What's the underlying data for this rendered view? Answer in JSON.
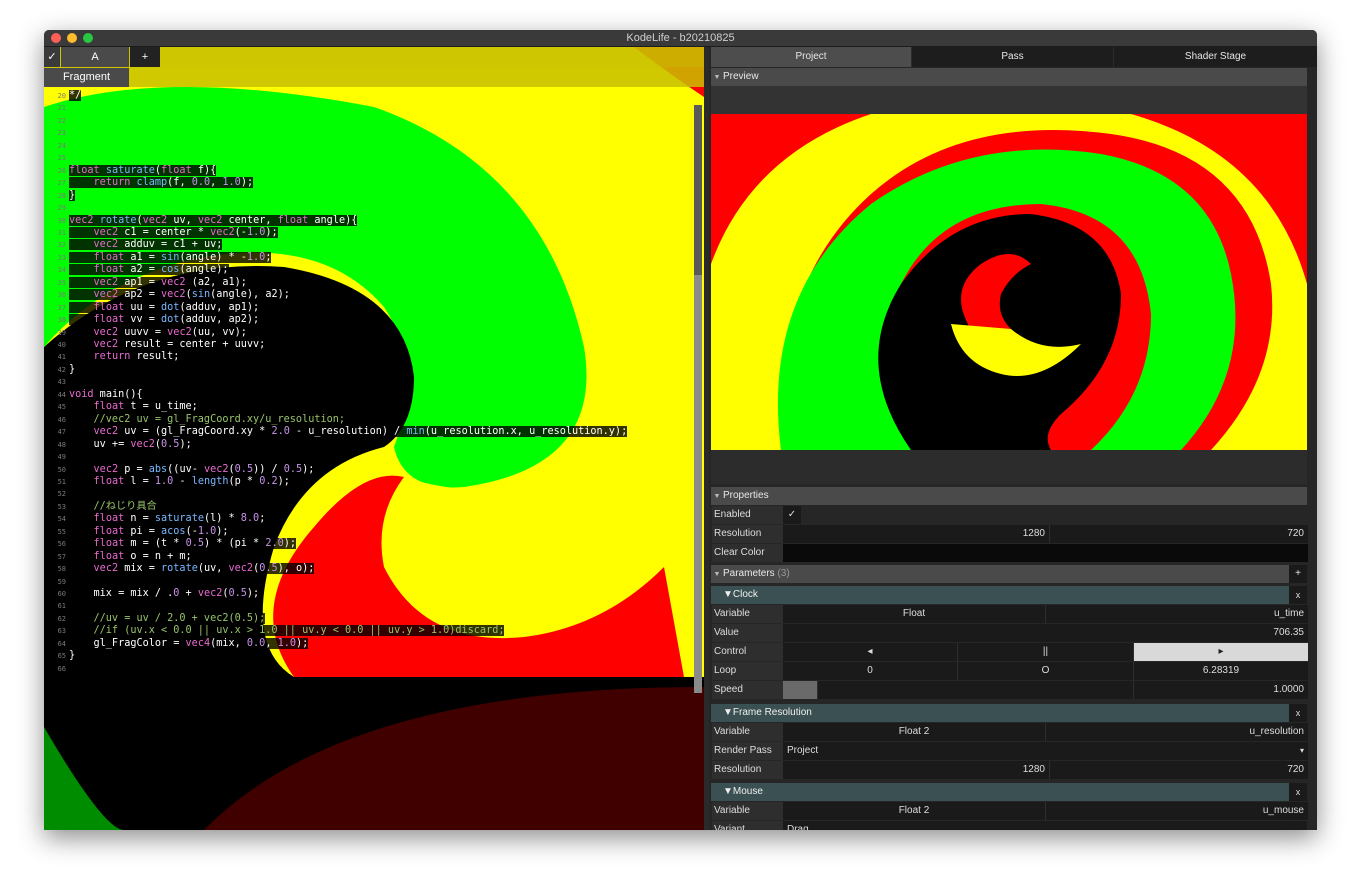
{
  "window": {
    "title": "KodeLife - b20210825"
  },
  "editor": {
    "tabs": {
      "check": "✓",
      "a": "A",
      "plus": "+"
    },
    "stage": "Fragment",
    "lines": [
      {
        "n": "20",
        "t": "*/"
      },
      {
        "n": "21",
        "t": ""
      },
      {
        "n": "22",
        "t": ""
      },
      {
        "n": "23",
        "t": ""
      },
      {
        "n": "24",
        "t": ""
      },
      {
        "n": "25",
        "t": ""
      },
      {
        "n": "26",
        "t": "float saturate(float f){"
      },
      {
        "n": "27",
        "t": "    return clamp(f, 0.0, 1.0);"
      },
      {
        "n": "28",
        "t": "}"
      },
      {
        "n": "29",
        "t": ""
      },
      {
        "n": "30",
        "t": "vec2 rotate(vec2 uv, vec2 center, float angle){"
      },
      {
        "n": "31",
        "t": "    vec2 c1 = center * vec2(-1.0);"
      },
      {
        "n": "32",
        "t": "    vec2 adduv = c1 + uv;"
      },
      {
        "n": "33",
        "t": "    float a1 = sin(angle) * -1.0;"
      },
      {
        "n": "34",
        "t": "    float a2 = cos(angle);"
      },
      {
        "n": "35",
        "t": "    vec2 ap1 = vec2 (a2, a1);"
      },
      {
        "n": "36",
        "t": "    vec2 ap2 = vec2(sin(angle), a2);"
      },
      {
        "n": "37",
        "t": "    float uu = dot(adduv, ap1);"
      },
      {
        "n": "38",
        "t": "    float vv = dot(adduv, ap2);"
      },
      {
        "n": "39",
        "t": "    vec2 uuvv = vec2(uu, vv);"
      },
      {
        "n": "40",
        "t": "    vec2 result = center + uuvv;"
      },
      {
        "n": "41",
        "t": "    return result;"
      },
      {
        "n": "42",
        "t": "}"
      },
      {
        "n": "43",
        "t": ""
      },
      {
        "n": "44",
        "t": "void main(){"
      },
      {
        "n": "45",
        "t": "    float t = u_time;"
      },
      {
        "n": "46",
        "t": "    //vec2 uv = gl_FragCoord.xy/u_resolution;"
      },
      {
        "n": "47",
        "t": "    vec2 uv = (gl_FragCoord.xy * 2.0 - u_resolution) / min(u_resolution.x, u_resolution.y);"
      },
      {
        "n": "48",
        "t": "    uv += vec2(0.5);"
      },
      {
        "n": "49",
        "t": ""
      },
      {
        "n": "50",
        "t": "    vec2 p = abs((uv- vec2(0.5)) / 0.5);"
      },
      {
        "n": "51",
        "t": "    float l = 1.0 - length(p * 0.2);"
      },
      {
        "n": "52",
        "t": ""
      },
      {
        "n": "53",
        "t": "    //ねじり具合"
      },
      {
        "n": "54",
        "t": "    float n = saturate(l) * 8.0;"
      },
      {
        "n": "55",
        "t": "    float pi = acos(-1.0);"
      },
      {
        "n": "56",
        "t": "    float m = (t * 0.5) * (pi * 2.0);"
      },
      {
        "n": "57",
        "t": "    float o = n + m;"
      },
      {
        "n": "58",
        "t": "    vec2 mix = rotate(uv, vec2(0.5), o);"
      },
      {
        "n": "59",
        "t": ""
      },
      {
        "n": "60",
        "t": "    mix = mix / .0 + vec2(0.5);"
      },
      {
        "n": "61",
        "t": ""
      },
      {
        "n": "62",
        "t": "    //uv = uv / 2.0 + vec2(0.5);"
      },
      {
        "n": "63",
        "t": "    //if (uv.x < 0.0 || uv.x > 1.0 || uv.y < 0.0 || uv.y > 1.0)discard;"
      },
      {
        "n": "64",
        "t": "    gl_FragColor = vec4(mix, 0.0, 1.0);"
      },
      {
        "n": "65",
        "t": "}"
      },
      {
        "n": "66",
        "t": ""
      }
    ]
  },
  "right_tabs": [
    "Project",
    "Pass",
    "Shader Stage"
  ],
  "preview": {
    "label": "Preview"
  },
  "properties": {
    "label": "Properties",
    "enabled_label": "Enabled",
    "enabled_value": "✓",
    "resolution_label": "Resolution",
    "res_w": "1280",
    "res_h": "720",
    "clear_color_label": "Clear Color"
  },
  "parameters": {
    "label": "Parameters",
    "count": "(3)",
    "add": "+",
    "clock": {
      "label": "Clock",
      "close": "x",
      "variable_label": "Variable",
      "type": "Float",
      "name": "u_time",
      "value_label": "Value",
      "value": "706.35",
      "control_label": "Control",
      "prev": "◂",
      "pause": "||",
      "play": "▸",
      "loop_label": "Loop",
      "loop_a": "0",
      "loop_b": "O",
      "loop_c": "6.28319",
      "speed_label": "Speed",
      "speed": "1.0000"
    },
    "frame_resolution": {
      "label": "Frame Resolution",
      "close": "x",
      "variable_label": "Variable",
      "type": "Float 2",
      "name": "u_resolution",
      "render_pass_label": "Render Pass",
      "render_pass": "Project",
      "dropdown": "▾",
      "resolution_label": "Resolution",
      "res_w": "1280",
      "res_h": "720"
    },
    "mouse": {
      "label": "Mouse",
      "close": "x",
      "variable_label": "Variable",
      "type": "Float 2",
      "name": "u_mouse",
      "variant_label": "Variant",
      "variant": "Drag"
    }
  },
  "colors": {
    "red": "#ff0000",
    "green": "#00ff00",
    "yellow": "#ffff00",
    "black": "#000000"
  }
}
